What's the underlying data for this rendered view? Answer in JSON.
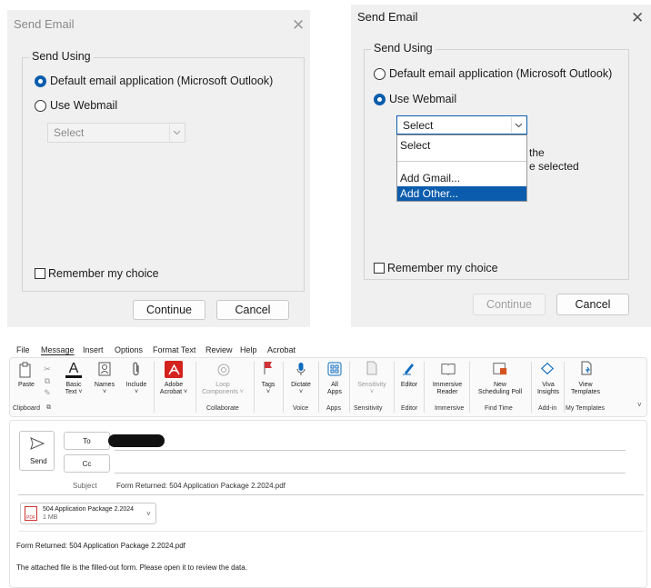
{
  "dialog_disabled": {
    "title": "Send Email",
    "close_glyph": "✕",
    "group_label": "Send Using",
    "option_default": "Default email application (Microsoft Outlook)",
    "option_webmail": "Use Webmail",
    "selected_option": "default",
    "webmail_select_value": "Select",
    "remember_label": "Remember my choice",
    "remember_checked": false,
    "continue_label": "Continue",
    "cancel_label": "Cancel"
  },
  "dialog_webmail": {
    "title": "Send Email",
    "close_glyph": "✕",
    "group_label": "Send Using",
    "option_default": "Default email application (Microsoft Outlook)",
    "option_webmail": "Use Webmail",
    "selected_option": "webmail",
    "webmail_select_value": "Select",
    "dropdown_options": [
      "Select",
      "Add Gmail...",
      "Add Other..."
    ],
    "highlighted_option": "Add Other...",
    "partial_text_line1": "the",
    "partial_text_line2": "e selected",
    "remember_label": "Remember my choice",
    "remember_checked": false,
    "continue_label": "Continue",
    "continue_disabled": true,
    "cancel_label": "Cancel"
  },
  "outlook": {
    "menu_tabs": [
      "File",
      "Message",
      "Insert",
      "Options",
      "Format Text",
      "Review",
      "Help",
      "Acrobat"
    ],
    "active_tab": "Message",
    "ribbon": {
      "paste": "Paste",
      "basic_text": "Basic\nText ˅",
      "names": "Names\n˅",
      "include": "Include\n˅",
      "adobe_acrobat": "Adobe\nAcrobat ˅",
      "loop_components": "Loop\nComponents ˅",
      "tags": "Tags\n˅",
      "dictate": "Dictate\n˅",
      "all_apps": "All\nApps",
      "sensitivity": "Sensitivity\n˅",
      "editor": "Editor",
      "immersive_reader": "Immersive\nReader",
      "new_scheduling_poll": "New\nScheduling Poll",
      "viva_insights": "Viva\nInsights",
      "view_templates": "View\nTemplates",
      "groups": {
        "clipboard": "Clipboard",
        "collaborate": "Collaborate",
        "voice": "Voice",
        "apps": "Apps",
        "sensitivity": "Sensitivity",
        "editor": "Editor",
        "immersive": "Immersive",
        "find_time": "Find Time",
        "add_in": "Add-in",
        "my_templates": "My Templates"
      },
      "colors": {
        "adobe_red": "#d4231f",
        "flag_red": "#d13438",
        "accent_blue": "#0f6cbd"
      }
    },
    "compose": {
      "send_label": "Send",
      "to_label": "To",
      "cc_label": "Cc",
      "subject_label": "Subject",
      "subject_value": "Form Returned: 504 Application Package 2.2024.pdf",
      "attachment_name": "504 Application Package 2.2024",
      "attachment_size": "1 MB",
      "attachment_ext": "PDF",
      "body_line1": "Form Returned: 504 Application Package 2.2024.pdf",
      "body_line2": "The attached file is the filled-out form. Please open it to review the data."
    }
  }
}
